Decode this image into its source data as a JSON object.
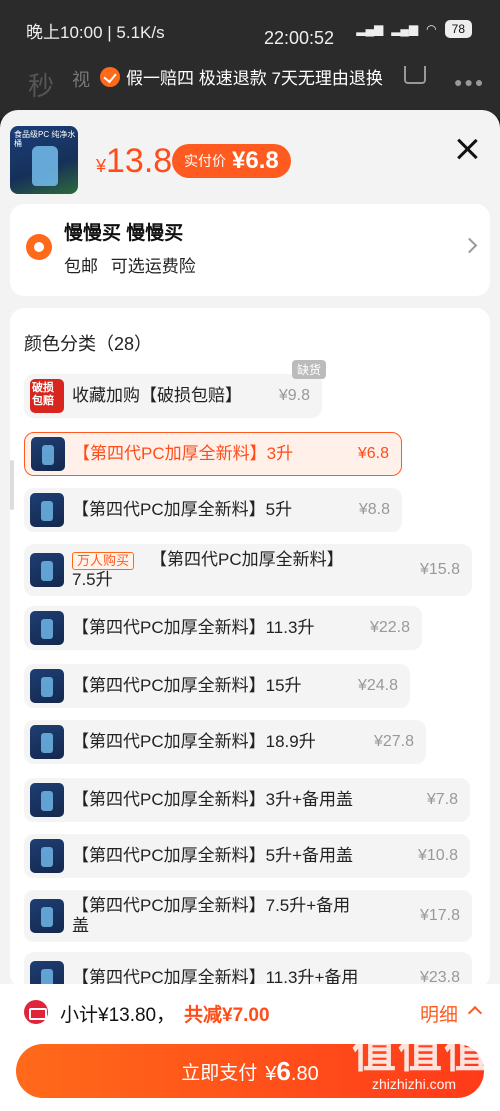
{
  "status_bar": {
    "left": "晚上10:00 | 5.1K/s",
    "clock": "22:00:52",
    "battery": "78"
  },
  "background": {
    "side_text": "秒",
    "tab_label": "视",
    "banner": "假一赔四 极速退款 7天无理由退换"
  },
  "header": {
    "product_thumb_label": "食品级PC 纯净水桶",
    "currency": "¥",
    "price": "13.8",
    "paid_label": "实付价",
    "paid_value": "¥6.8"
  },
  "address": {
    "title": "慢慢买 慢慢买",
    "subtitle": "包邮 可选运费险"
  },
  "variants": {
    "title": "颜色分类（28）",
    "items": [
      {
        "name": "收藏加购【破损包赔】",
        "price": "¥9.8",
        "tag": "缺货",
        "thumb_text": "破损包赔"
      },
      {
        "name": "【第四代PC加厚全新料】3升",
        "price": "¥6.8",
        "selected": true
      },
      {
        "name": "【第四代PC加厚全新料】5升",
        "price": "¥8.8"
      },
      {
        "name_line1": "【第四代PC加厚全新料】",
        "name_line2": "7.5升",
        "hot": "万人购买",
        "price": "¥15.8"
      },
      {
        "name": "【第四代PC加厚全新料】11.3升",
        "price": "¥22.8"
      },
      {
        "name": "【第四代PC加厚全新料】15升",
        "price": "¥24.8"
      },
      {
        "name": "【第四代PC加厚全新料】18.9升",
        "price": "¥27.8"
      },
      {
        "name": "【第四代PC加厚全新料】3升+备用盖",
        "price": "¥7.8"
      },
      {
        "name": "【第四代PC加厚全新料】5升+备用盖",
        "price": "¥10.8"
      },
      {
        "name_line1": "【第四代PC加厚全新料】7.5升+备用",
        "name_line2": "盖",
        "price": "¥17.8"
      },
      {
        "name": "【第四代PC加厚全新料】11.3升+备用",
        "price": "¥23.8"
      }
    ]
  },
  "footer": {
    "subtotal": "小计¥13.80，",
    "discount": "共减¥7.00",
    "detail": "明细",
    "pay_label": "立即支付",
    "pay_currency": "¥",
    "pay_int": "6",
    "pay_dec": ".80"
  },
  "watermark": {
    "text": "值值值",
    "url": "zhizhizhi.com"
  }
}
